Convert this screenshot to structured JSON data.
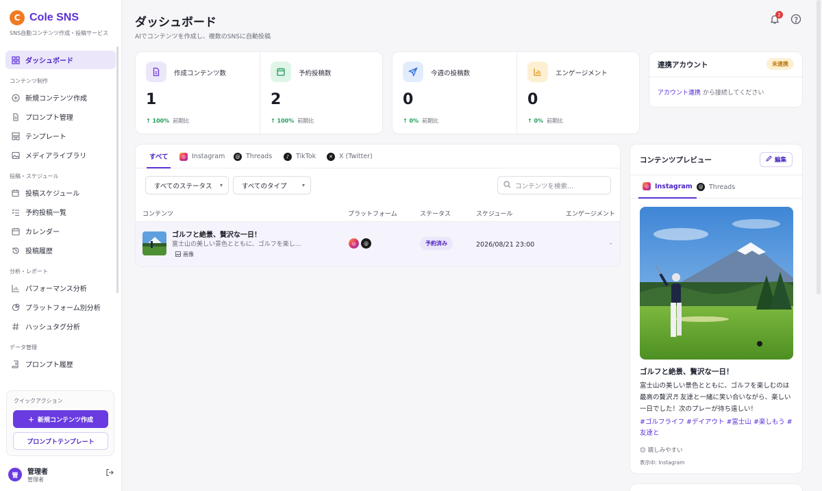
{
  "brand": {
    "logo_letter": "C",
    "name": "Cole SNS",
    "subtitle": "SNS自動コンテンツ作成・投稿サービス"
  },
  "sidebar": {
    "dashboard": "ダッシュボード",
    "sections": [
      {
        "title": "コンテンツ制作",
        "items": [
          "新規コンテンツ作成",
          "プロンプト管理",
          "テンプレート",
          "メディアライブラリ"
        ]
      },
      {
        "title": "投稿・スケジュール",
        "items": [
          "投稿スケジュール",
          "予約投稿一覧",
          "カレンダー",
          "投稿履歴"
        ]
      },
      {
        "title": "分析・レポート",
        "items": [
          "パフォーマンス分析",
          "プラットフォーム別分析",
          "ハッシュタグ分析"
        ]
      },
      {
        "title": "データ管理",
        "items": [
          "プロンプト履歴"
        ]
      }
    ],
    "quick_actions": {
      "title": "クイックアクション",
      "new_content": "新規コンテンツ作成",
      "prompt_template": "プロンプトテンプレート"
    },
    "user": {
      "avatar": "管",
      "name": "管理者",
      "role": "管理者"
    }
  },
  "header": {
    "title": "ダッシュボード",
    "subtitle": "AIでコンテンツを作成し、複数のSNSに自動投稿",
    "notification_count": "2"
  },
  "stats": [
    {
      "label": "作成コンテンツ数",
      "value": "1",
      "change": "100%",
      "period": "前期比",
      "color": "#6a3be0",
      "bg": "#ece6fb"
    },
    {
      "label": "予約投稿数",
      "value": "2",
      "change": "100%",
      "period": "前期比",
      "color": "#1e9b5a",
      "bg": "#dff5e8"
    },
    {
      "label": "今週の投稿数",
      "value": "0",
      "change": "0%",
      "period": "前期比",
      "color": "#2f6fe0",
      "bg": "#e2ecfc"
    },
    {
      "label": "エンゲージメント",
      "value": "0",
      "change": "0%",
      "period": "前期比",
      "color": "#d9951a",
      "bg": "#fdf0d2"
    }
  ],
  "accounts": {
    "title": "連携アカウント",
    "badge": "未連携",
    "link": "アカウント連携",
    "text": "から接続してください"
  },
  "content_table": {
    "tabs": [
      "すべて",
      "Instagram",
      "Threads",
      "TikTok",
      "X (Twitter)"
    ],
    "filters": {
      "status": "すべてのステータス",
      "type": "すべてのタイプ"
    },
    "search_placeholder": "コンテンツを検索...",
    "columns": [
      "コンテンツ",
      "プラットフォーム",
      "ステータス",
      "スケジュール",
      "エンゲージメント"
    ],
    "rows": [
      {
        "title": "ゴルフと絶景、贅沢な一日！",
        "desc": "富士山の美しい景色とともに、ゴルフを楽し...",
        "type": "画像",
        "status": "予約済み",
        "schedule": "2026/08/21 23:00",
        "engagement": "-"
      }
    ]
  },
  "preview": {
    "title": "コンテンツプレビュー",
    "edit": "編集",
    "tabs": [
      "Instagram",
      "Threads"
    ],
    "post_title": "ゴルフと絶景、贅沢な一日！",
    "post_body": "富士山の美しい景色とともに、ゴルフを楽しむのは最高の贅沢♬ 友達と一緒に笑い合いながら、楽しい一日でした！次のプレーが待ち遠しい！",
    "tags": "#ゴルフライフ #デイアウト #富士山 #楽しもう #友達と",
    "tone": "親しみやすい",
    "tone_emoji": "😊",
    "showing": "表示中: Instagram"
  }
}
